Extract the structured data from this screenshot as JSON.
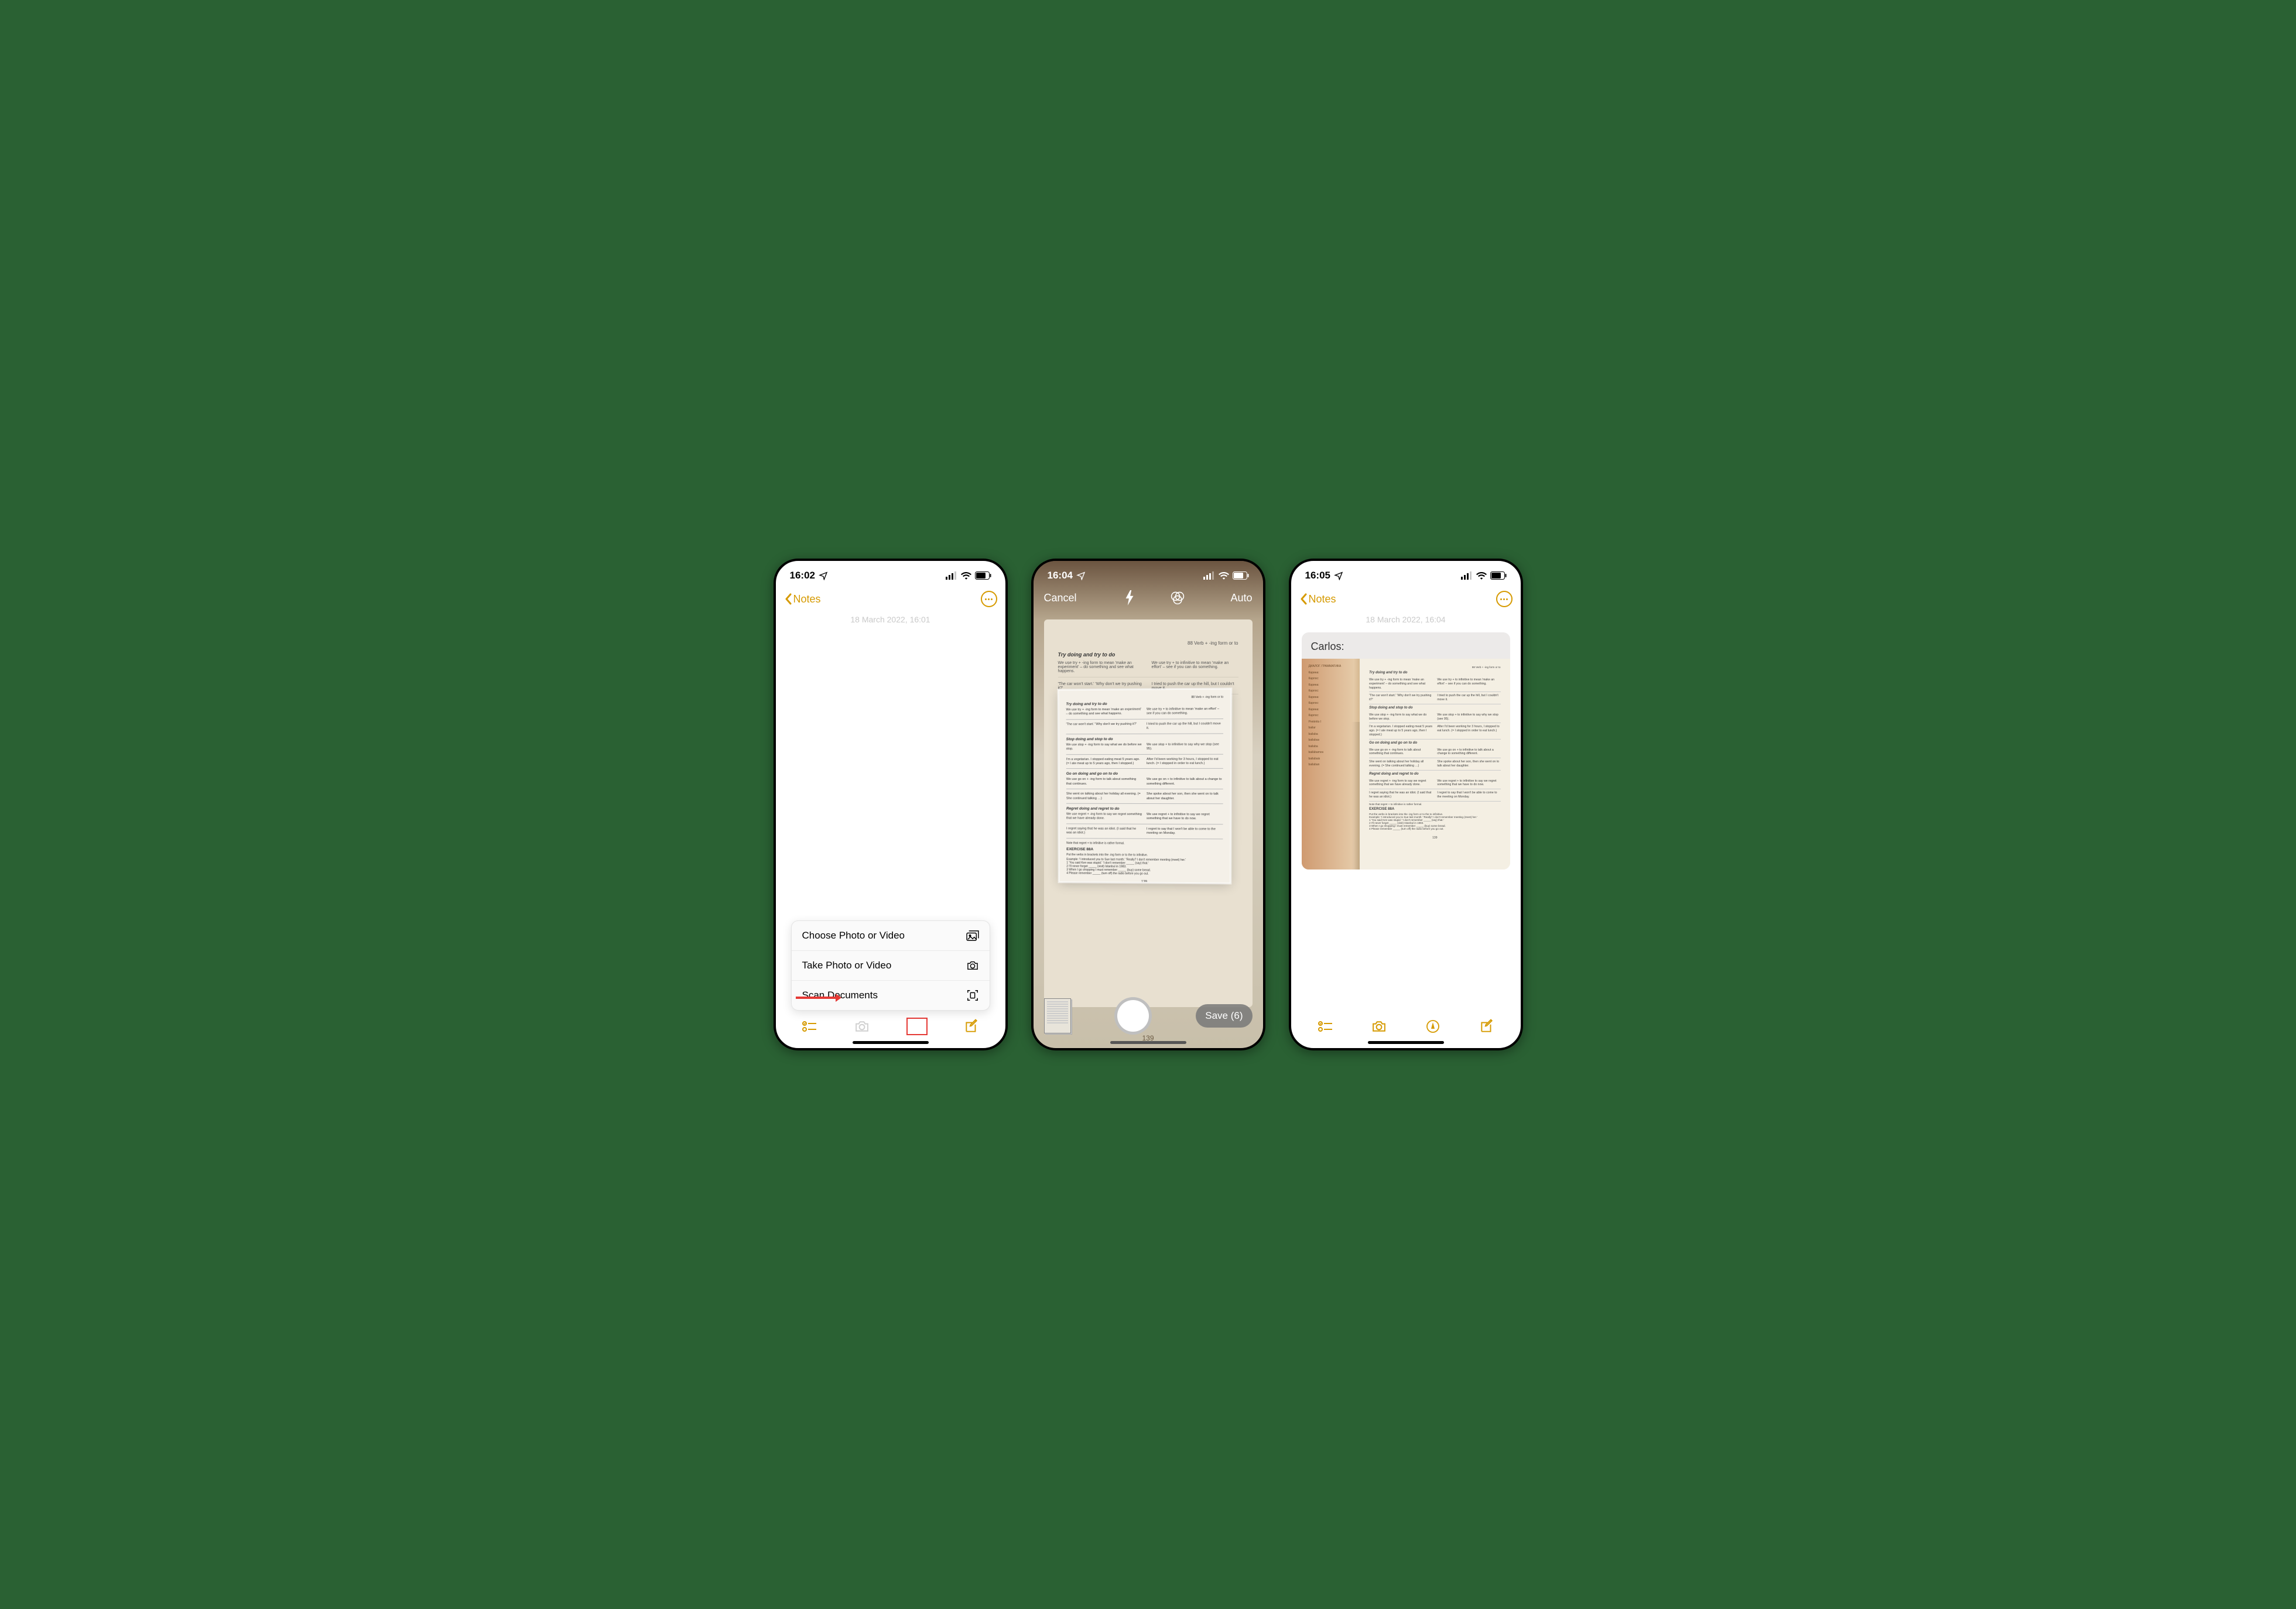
{
  "screens": {
    "s1": {
      "status_time": "16:02",
      "back_label": "Notes",
      "note_date": "18 March 2022, 16:01",
      "sheet": {
        "choose": "Choose Photo or Video",
        "take": "Take Photo or Video",
        "scan": "Scan Documents"
      }
    },
    "s2": {
      "status_time": "16:04",
      "cancel": "Cancel",
      "auto": "Auto",
      "save": "Save (6)",
      "page_heading": "88   Verb + -ing form or to",
      "page_number": "139",
      "doc": {
        "h1": "Try doing and try to do",
        "r1a": "We use try + -ing form to mean 'make an experiment' – do something and see what happens.",
        "r1b": "We use try + to infinitive to mean 'make an effort' – see if you can do something.",
        "r1ex_a": "'The car won't start.'   'Why don't we try pushing it?'",
        "r1ex_b": "I tried to push the car up the hill, but I couldn't move it.",
        "h2": "Stop doing and stop to do",
        "r2a": "We use stop + -ing form to say what we do before we stop.",
        "r2b": "We use stop + to infinitive to say why we stop (see 95).",
        "r2ex_a": "I'm a vegetarian. I stopped eating meat 5 years ago. (= I ate meat up to 5 years ago, then I stopped.)",
        "r2ex_b": "After I'd been working for 3 hours, I stopped to eat lunch. (= I stopped in order to eat lunch.)",
        "h3": "Go on doing and go on to do",
        "r3a": "We use go on + -ing form to talk about something that continues.",
        "r3b": "We use go on + to infinitive to talk about a change to something different.",
        "r3ex_a": "She went on talking about her holiday all evening. (= She continued talking …)",
        "r3ex_b": "She spoke about her son, then she went on to talk about her daughter.",
        "h4": "Regret doing and regret to do",
        "r4a": "We use regret + -ing form to say we regret something that we have already done.",
        "r4b": "We use regret + to infinitive to say we regret something that we have to do now.",
        "r4ex_a": "I regret saying that he was an idiot. (I said that he was an idiot.)",
        "r4ex_b": "I regret to say that I won't be able to come to the meeting on Monday.",
        "note": "Note that regret + to infinitive is rather formal.",
        "ex_hdr": "EXERCISE 88A",
        "ex_intro": "Put the verbs in brackets into the -ing form or to the to infinitive.",
        "ex_example": "Example:  'I introduced you to Sue last month.'   'Really? I don't remember meeting (meet) her.'",
        "ex1": "1  'You said Ken was stupid.' 'I don't remember _____ (say) that.'",
        "ex2": "2  I'll never forget _____ (visit) Istanbul in 1983.",
        "ex3": "3  When I go shopping I must remember _____ (buy) some bread.",
        "ex4": "4  Please remember _____ (turn off) the radio before you go out."
      }
    },
    "s3": {
      "status_time": "16:05",
      "back_label": "Notes",
      "note_date": "18 March 2022, 16:04",
      "attachment_title": "Carlos:",
      "left_lines": [
        "ДИАЛОГ. ГРАММАТИКА",
        "Карина:",
        "Карлос:",
        "Карина:",
        "Карлос:",
        "Карина:",
        "Карлос:",
        "Карина:",
        "Карлос:",
        "Pretérito I",
        "bailar",
        "bailaba",
        "bailabas",
        "bailaba",
        "bailábamos",
        "bailabais",
        "bailaban"
      ]
    }
  }
}
